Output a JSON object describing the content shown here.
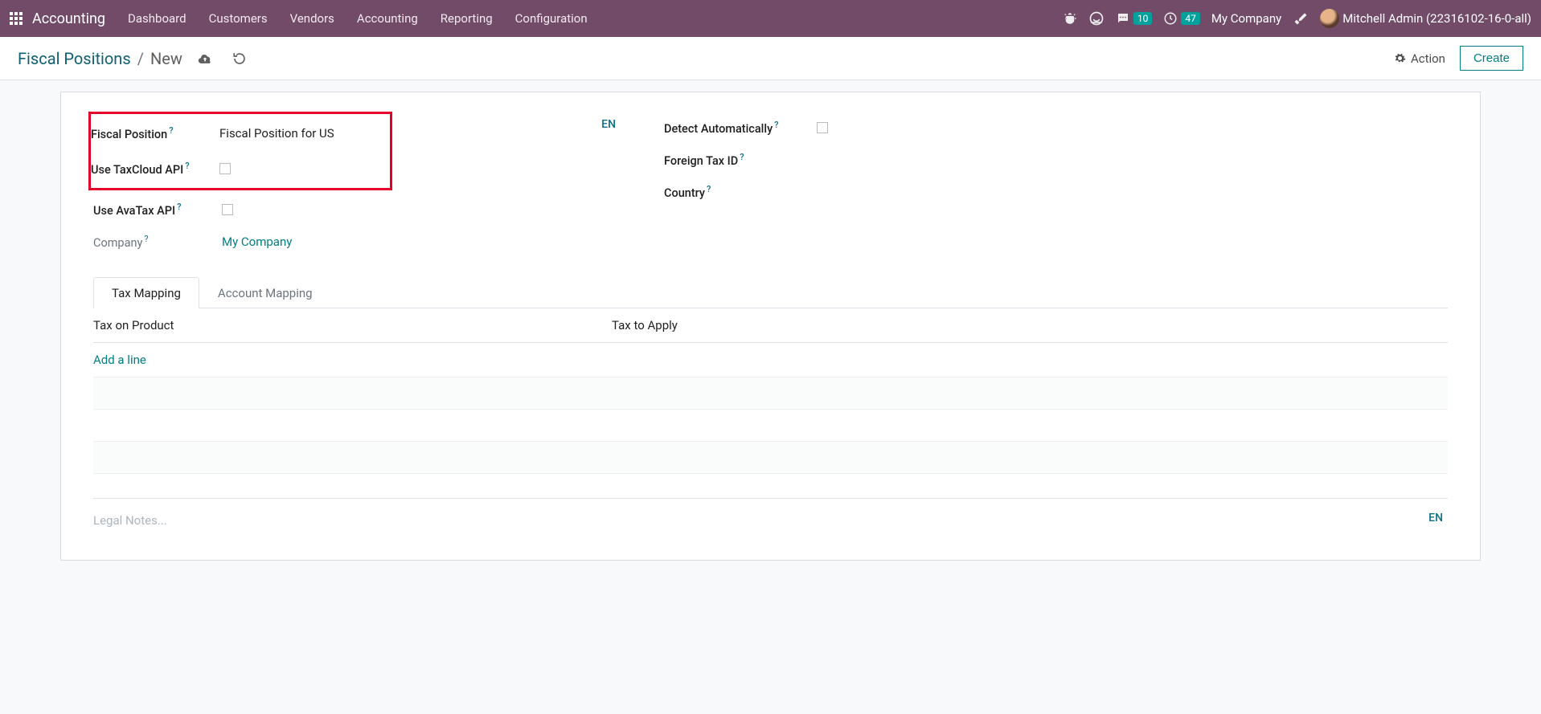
{
  "navbar": {
    "brand": "Accounting",
    "menu": [
      "Dashboard",
      "Customers",
      "Vendors",
      "Accounting",
      "Reporting",
      "Configuration"
    ],
    "messages_badge": "10",
    "activities_badge": "47",
    "company": "My Company",
    "user": "Mitchell Admin (22316102-16-0-all)"
  },
  "control_panel": {
    "breadcrumb_root": "Fiscal Positions",
    "breadcrumb_current": "New",
    "action_label": "Action",
    "create_label": "Create"
  },
  "form": {
    "left": {
      "fiscal_position_label": "Fiscal Position",
      "fiscal_position_value": "Fiscal Position for US",
      "lang_toggle": "EN",
      "use_taxcloud_label": "Use TaxCloud API",
      "use_avatax_label": "Use AvaTax API",
      "company_label": "Company",
      "company_value": "My Company"
    },
    "right": {
      "detect_auto_label": "Detect Automatically",
      "foreign_tax_label": "Foreign Tax ID",
      "country_label": "Country"
    }
  },
  "tabs": {
    "tax_mapping": "Tax Mapping",
    "account_mapping": "Account Mapping",
    "col_a": "Tax on Product",
    "col_b": "Tax to Apply",
    "add_line": "Add a line"
  },
  "notes": {
    "placeholder": "Legal Notes...",
    "lang_toggle": "EN"
  }
}
